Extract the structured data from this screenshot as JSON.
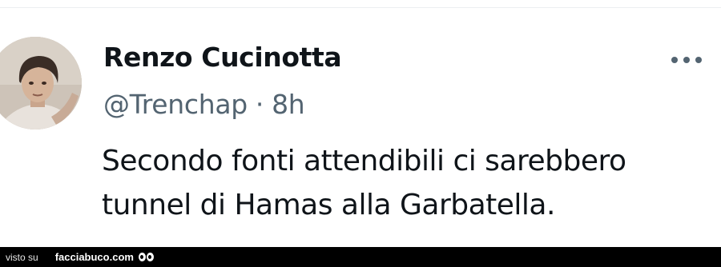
{
  "tweet": {
    "display_name": "Renzo Cucinotta",
    "handle": "@Trenchap",
    "separator": "·",
    "time": "8h",
    "text_line_1": "Secondo fonti attendibili ci sarebbero",
    "text_line_2": "tunnel di Hamas alla Garbatella.",
    "more_icon": "more-horizontal-icon"
  },
  "footer": {
    "visto_label": "visto su",
    "site_label": "facciabuco.com"
  },
  "colors": {
    "name": "#0f1419",
    "secondary": "#536471",
    "footer_bg": "#000000"
  }
}
